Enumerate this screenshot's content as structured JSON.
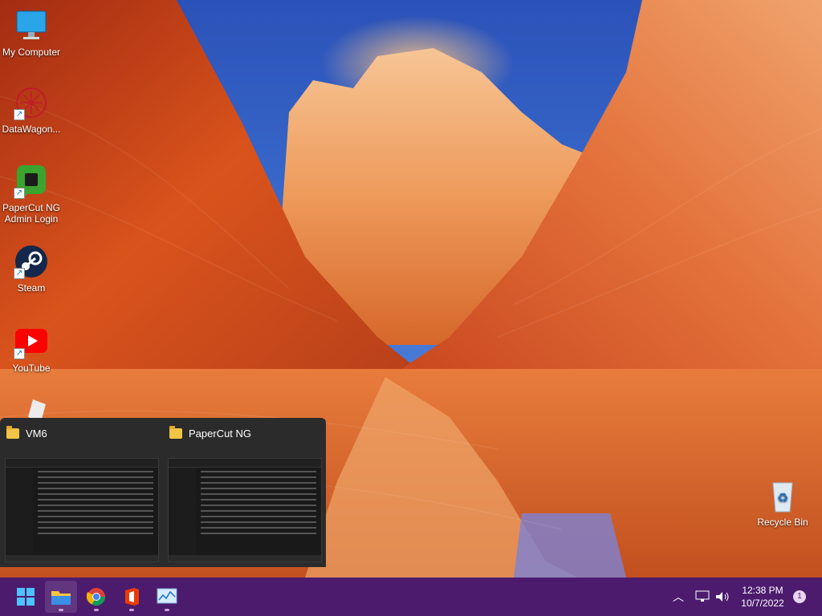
{
  "desktop": {
    "icons": [
      {
        "label": "My Computer",
        "icon": "monitor-icon"
      },
      {
        "label": "DataWagon...",
        "icon": "datawagon-icon"
      },
      {
        "label": "PaperCut NG Admin Login",
        "label_line1": "PaperCut NG",
        "label_line2": "Admin Login",
        "icon": "papercut-icon"
      },
      {
        "label": "Steam",
        "icon": "steam-icon"
      },
      {
        "label": "YouTube",
        "icon": "youtube-icon"
      },
      {
        "label": "",
        "icon": "roblox-icon"
      },
      {
        "label": "Recycle Bin",
        "icon": "recycle-bin-icon"
      }
    ]
  },
  "taskbar_preview": {
    "windows": [
      {
        "title": "VM6",
        "icon": "folder-icon"
      },
      {
        "title": "PaperCut NG",
        "icon": "folder-icon"
      }
    ]
  },
  "taskbar": {
    "apps": [
      {
        "name": "Start",
        "icon": "windows-start-icon"
      },
      {
        "name": "File Explorer",
        "icon": "file-explorer-icon",
        "active": true
      },
      {
        "name": "Chrome",
        "icon": "chrome-icon"
      },
      {
        "name": "Office",
        "icon": "office-icon"
      },
      {
        "name": "Monitor",
        "icon": "performance-monitor-icon"
      }
    ],
    "tray": {
      "time": "12:38 PM",
      "date": "10/7/2022",
      "notification_count": "1"
    }
  },
  "colors": {
    "taskbar": "#4c1b6e",
    "sky": "#2b52b8",
    "rock": "#d9531c"
  }
}
